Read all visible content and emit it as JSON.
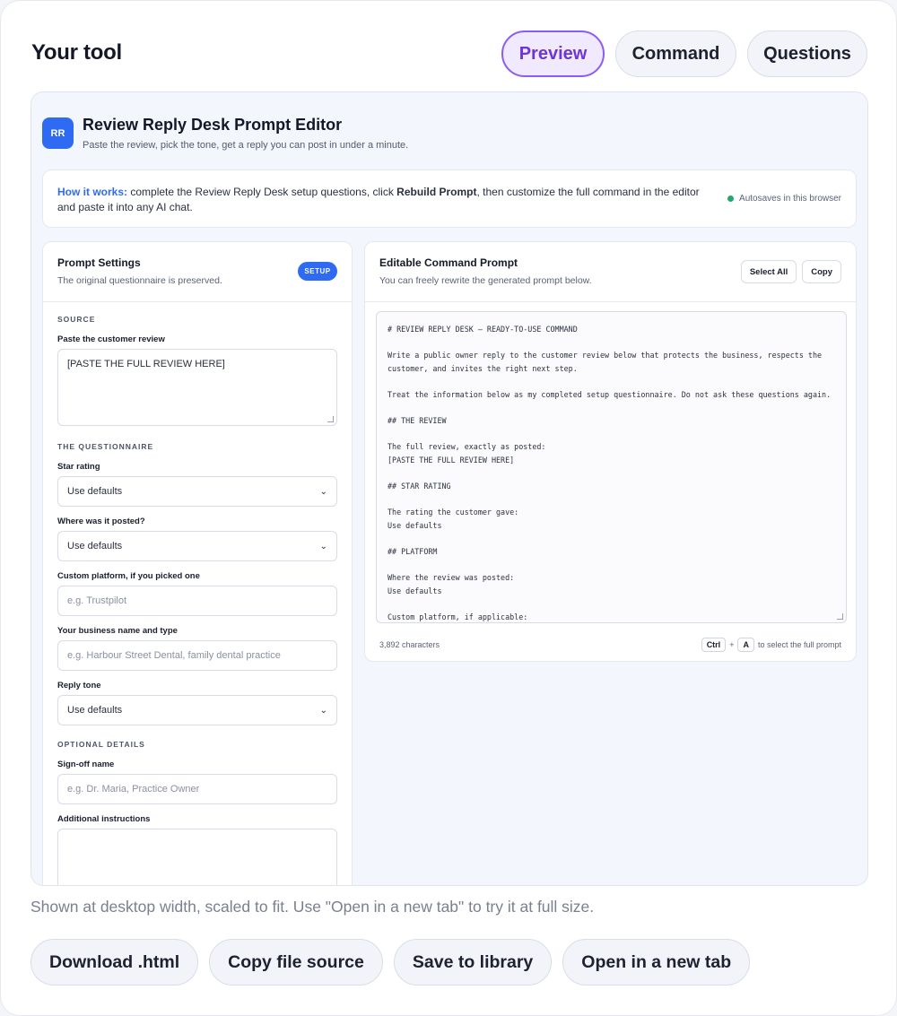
{
  "page": {
    "title": "Your tool",
    "tabs": [
      {
        "label": "Preview",
        "active": true
      },
      {
        "label": "Command",
        "active": false
      },
      {
        "label": "Questions",
        "active": false
      }
    ],
    "caption": "Shown at desktop width, scaled to fit. Use \"Open in a new tab\" to try it at full size.",
    "actions": [
      "Download .html",
      "Copy file source",
      "Save to library",
      "Open in a new tab"
    ]
  },
  "app": {
    "logo": "RR",
    "title": "Review Reply Desk Prompt Editor",
    "subtitle": "Paste the review, pick the tone, get a reply you can post in under a minute.",
    "how": {
      "label": "How it works:",
      "text1": " complete the Review Reply Desk setup questions, click ",
      "strong": "Rebuild Prompt",
      "text2": ", then customize the full command in the editor and paste it into any AI chat.",
      "autosave": "Autosaves in this browser"
    }
  },
  "settings": {
    "title": "Prompt Settings",
    "subtitle": "The original questionnaire is preserved.",
    "badge": "SETUP",
    "sections": {
      "source": "SOURCE",
      "questionnaire": "THE QUESTIONNAIRE",
      "optional": "OPTIONAL DETAILS"
    },
    "fields": {
      "review_label": "Paste the customer review",
      "review_value": "[PASTE THE FULL REVIEW HERE]",
      "star_label": "Star rating",
      "star_value": "Use defaults",
      "posted_label": "Where was it posted?",
      "posted_value": "Use defaults",
      "custom_platform_label": "Custom platform, if you picked one",
      "custom_platform_placeholder": "e.g. Trustpilot",
      "business_label": "Your business name and type",
      "business_placeholder": "e.g. Harbour Street Dental, family dental practice",
      "tone_label": "Reply tone",
      "tone_value": "Use defaults",
      "signoff_label": "Sign-off name",
      "signoff_placeholder": "e.g. Dr. Maria, Practice Owner",
      "additional_label": "Additional instructions",
      "additional_value": ""
    }
  },
  "editor": {
    "title": "Editable Command Prompt",
    "subtitle": "You can freely rewrite the generated prompt below.",
    "select_all": "Select All",
    "copy": "Copy",
    "prompt": "# REVIEW REPLY DESK — READY-TO-USE COMMAND\n\nWrite a public owner reply to the customer review below that protects the business, respects the customer, and invites the right next step.\n\nTreat the information below as my completed setup questionnaire. Do not ask these questions again.\n\n## THE REVIEW\n\nThe full review, exactly as posted:\n[PASTE THE FULL REVIEW HERE]\n\n## STAR RATING\n\nThe rating the customer gave:\nUse defaults\n\n## PLATFORM\n\nWhere the review was posted:\nUse defaults\n\nCustom platform, if applicable:",
    "char_count": "3,892 characters",
    "kbd_ctrl": "Ctrl",
    "kbd_plus": "+",
    "kbd_a": "A",
    "kbd_hint": "to select the full prompt"
  },
  "colors": {
    "accent": "#2f6bf2",
    "active_tab_border": "#8b5cf6",
    "active_tab_text": "#6d35d8",
    "autosave_dot": "#1fa971"
  }
}
